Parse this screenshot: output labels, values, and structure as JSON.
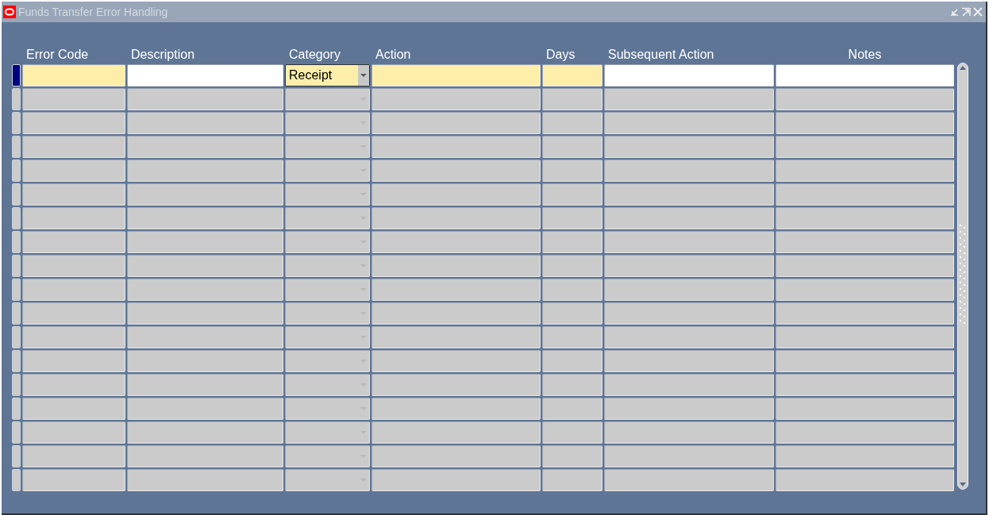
{
  "window": {
    "title": "Funds Transfer Error Handling"
  },
  "table": {
    "columns": [
      {
        "label": "Error Code",
        "kind": "text",
        "required": true
      },
      {
        "label": "Description",
        "kind": "text",
        "required": false
      },
      {
        "label": "Category",
        "kind": "dropdown",
        "required": true
      },
      {
        "label": "Action",
        "kind": "text",
        "required": true
      },
      {
        "label": "Days",
        "kind": "text",
        "required": true
      },
      {
        "label": "Subsequent Action",
        "kind": "text",
        "required": false
      },
      {
        "label": "Notes",
        "kind": "text",
        "required": false
      }
    ],
    "rows": [
      {
        "selected": true,
        "category": "Receipt"
      },
      {
        "selected": false
      },
      {
        "selected": false
      },
      {
        "selected": false
      },
      {
        "selected": false
      },
      {
        "selected": false
      },
      {
        "selected": false
      },
      {
        "selected": false
      },
      {
        "selected": false
      },
      {
        "selected": false
      },
      {
        "selected": false
      },
      {
        "selected": false
      },
      {
        "selected": false
      },
      {
        "selected": false
      },
      {
        "selected": false
      },
      {
        "selected": false
      },
      {
        "selected": false
      },
      {
        "selected": false
      }
    ]
  }
}
